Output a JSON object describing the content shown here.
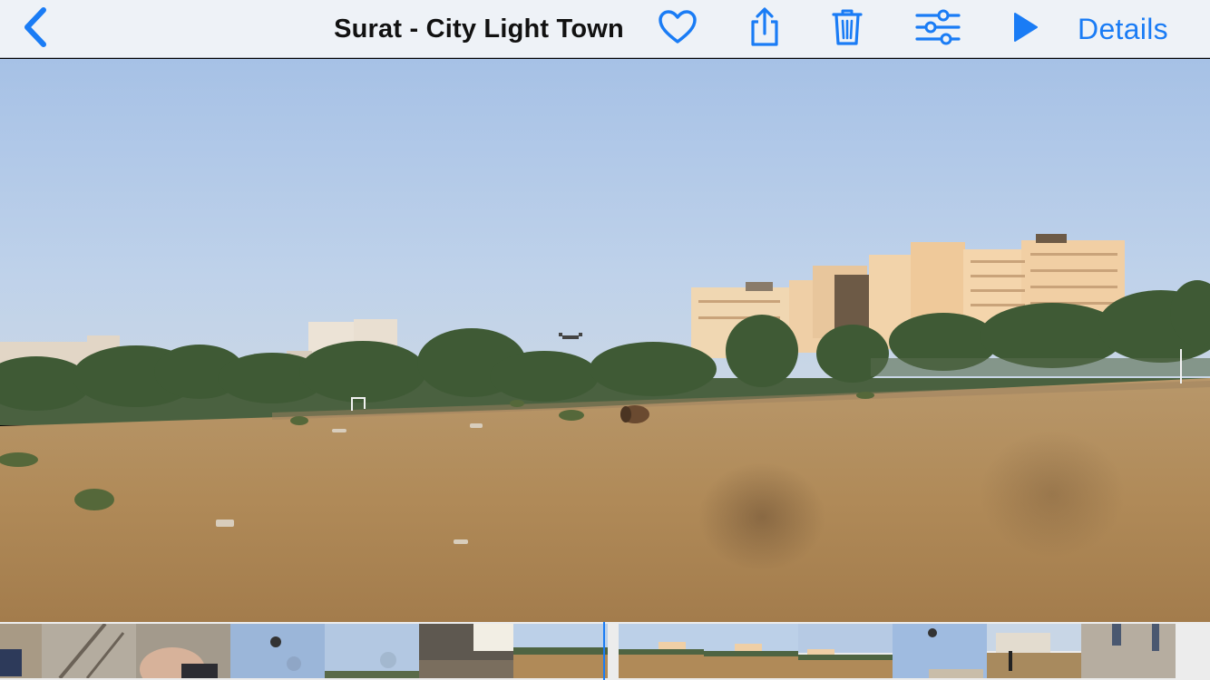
{
  "navbar": {
    "back_icon": "chevron-left-icon",
    "title": "Surat - City Light Town",
    "favorite_icon": "heart-outline-icon",
    "share_icon": "share-icon",
    "delete_icon": "trash-icon",
    "edit_icon": "sliders-icon",
    "play_icon": "play-icon",
    "details_label": "Details"
  },
  "colors": {
    "accent": "#1a7cf5",
    "navbar_bg": "#eef2f7",
    "sky_top": "#a9c3e6",
    "ground": "#b08a58"
  },
  "photo": {
    "description_icon": "video-frame"
  },
  "filmstrip": {
    "frames": [
      "frame-1",
      "frame-2",
      "frame-3",
      "frame-4",
      "frame-5",
      "frame-6",
      "frame-7",
      "frame-8",
      "frame-9",
      "frame-10",
      "frame-11",
      "frame-12",
      "frame-13"
    ]
  }
}
